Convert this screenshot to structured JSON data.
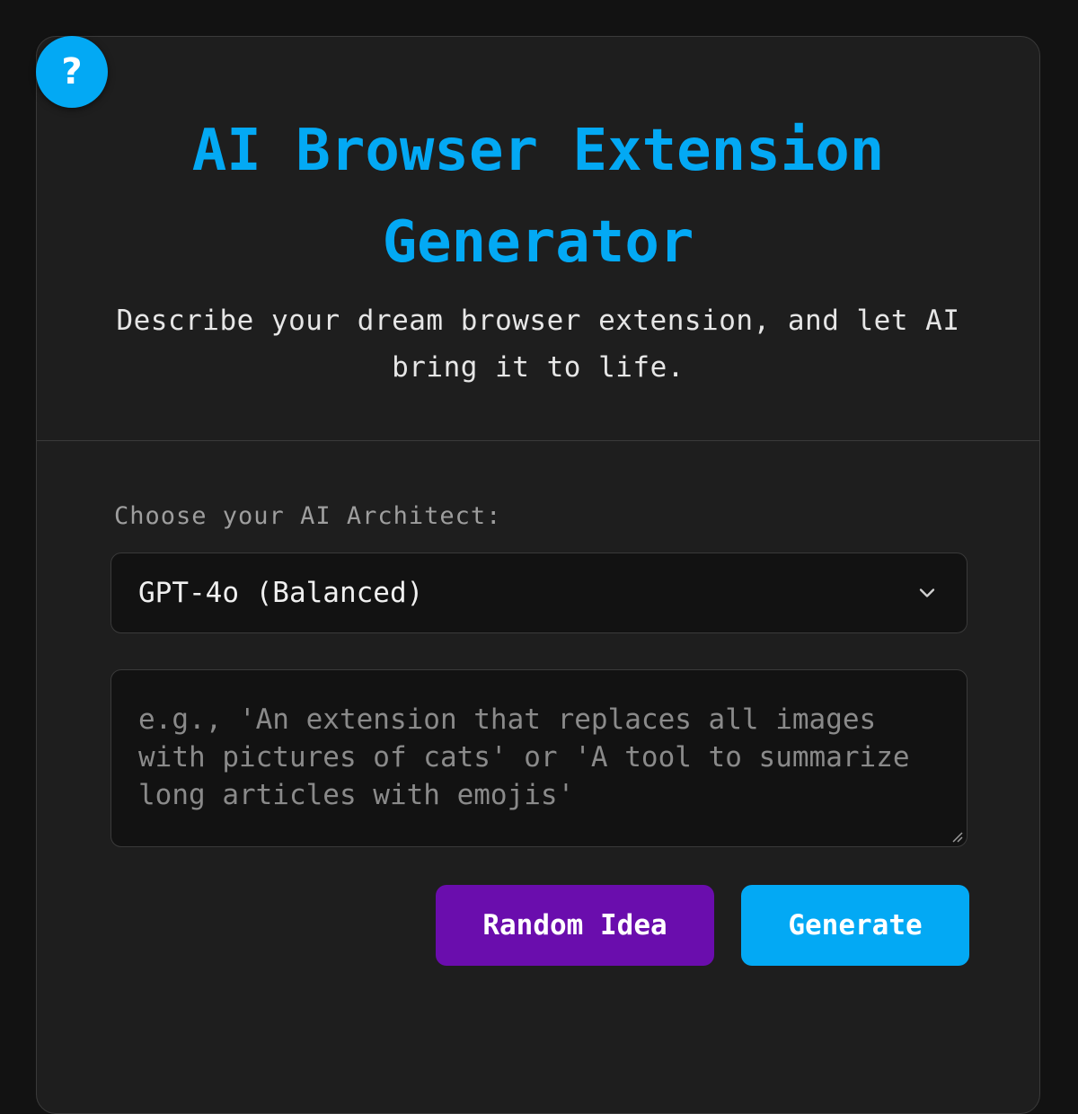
{
  "help": {
    "icon_glyph": "?",
    "icon": "question-mark-icon"
  },
  "header": {
    "title": "AI Browser Extension Generator",
    "subtitle": "Describe your dream browser extension, and let AI bring it to life."
  },
  "form": {
    "model_label": "Choose your AI Architect:",
    "model_selected": "GPT-4o (Balanced)",
    "prompt_placeholder": "e.g., 'An extension that replaces all images with pictures of cats' or 'A tool to summarize long articles with emojis'",
    "prompt_value": ""
  },
  "actions": {
    "random_label": "Random Idea",
    "generate_label": "Generate"
  },
  "colors": {
    "accent": "#03a9f4",
    "random_button": "#6a0dad",
    "background": "#121212",
    "card": "#1e1e1e"
  }
}
